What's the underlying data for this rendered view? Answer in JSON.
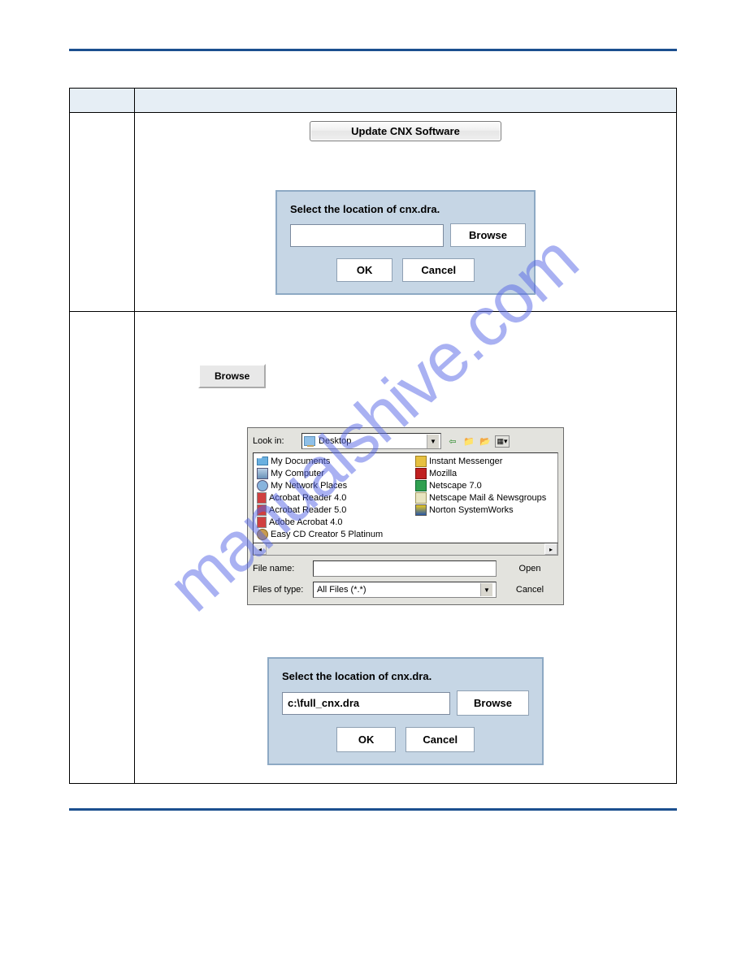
{
  "top_button": "Update CNX Software",
  "dialog1": {
    "title": "Select the location of cnx.dra.",
    "input_value": "",
    "browse": "Browse",
    "ok": "OK",
    "cancel": "Cancel"
  },
  "browse_button_standalone": "Browse",
  "file_dialog": {
    "lookin_label": "Look in:",
    "lookin_value": "Desktop",
    "items_left": [
      "My Documents",
      "My Computer",
      "My Network Places",
      "Acrobat Reader 4.0",
      "Acrobat Reader 5.0",
      "Adobe Acrobat 4.0"
    ],
    "items_right": [
      "Easy CD Creator 5 Platinum",
      "Instant Messenger",
      "Mozilla",
      "Netscape 7.0",
      "Netscape Mail & Newsgroups",
      "Norton SystemWorks"
    ],
    "file_name_label": "File name:",
    "file_name_value": "",
    "file_type_label": "Files of type:",
    "file_type_value": "All Files (*.*)",
    "open": "Open",
    "cancel": "Cancel"
  },
  "dialog2": {
    "title": "Select the location of cnx.dra.",
    "input_value": "c:\\full_cnx.dra",
    "browse": "Browse",
    "ok": "OK",
    "cancel": "Cancel"
  },
  "watermark": "manualshive.com"
}
